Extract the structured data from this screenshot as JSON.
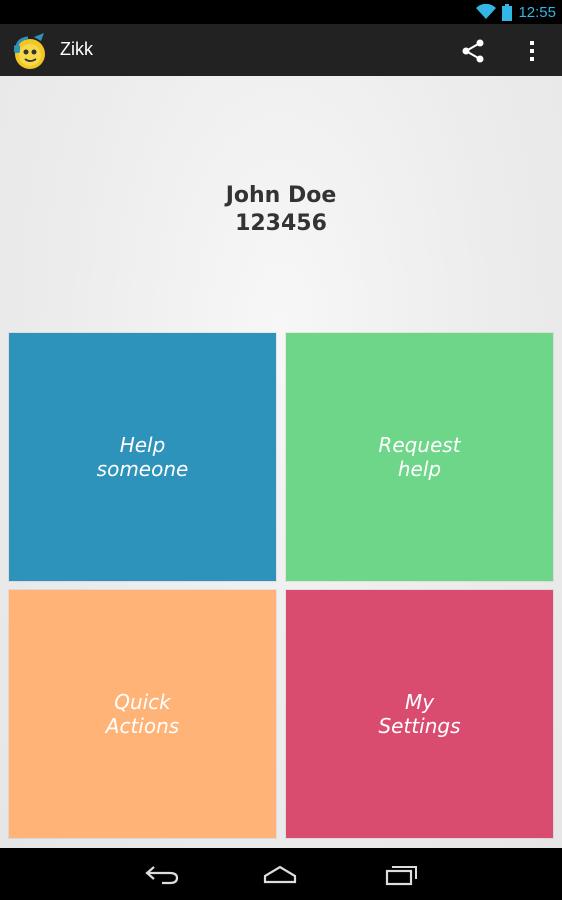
{
  "status_bar": {
    "time": "12:55",
    "icons": [
      "wifi-icon",
      "battery-icon"
    ],
    "accent_color": "#33b5e5"
  },
  "action_bar": {
    "title": "Zikk",
    "logo": "app-logo-icon",
    "actions": [
      "share-icon",
      "overflow-menu-icon"
    ],
    "background": "#222222"
  },
  "profile": {
    "name": "John Doe",
    "id": "123456"
  },
  "tiles": [
    {
      "line1": "Help",
      "line2": "someone",
      "color": "#2e93bb"
    },
    {
      "line1": "Request",
      "line2": "help",
      "color": "#6dd688"
    },
    {
      "line1": "Quick",
      "line2": "Actions",
      "color": "#ffb377"
    },
    {
      "line1": "My",
      "line2": "Settings",
      "color": "#d94c6f"
    }
  ],
  "nav_bar": {
    "buttons": [
      "back-icon",
      "home-icon",
      "recent-apps-icon"
    ]
  }
}
